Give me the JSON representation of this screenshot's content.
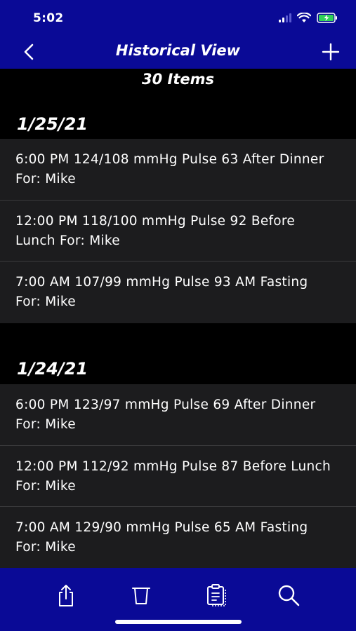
{
  "status_bar": {
    "time": "5:02"
  },
  "nav": {
    "title": "Historical View"
  },
  "items_count": "30 Items",
  "sections": [
    {
      "date": "1/25/21",
      "rows": [
        "6:00 PM 124/108 mmHg Pulse 63 After Dinner For: Mike",
        "12:00 PM 118/100 mmHg Pulse 92 Before Lunch For: Mike",
        "7:00 AM 107/99 mmHg Pulse 93 AM Fasting For: Mike"
      ]
    },
    {
      "date": "1/24/21",
      "rows": [
        "6:00 PM 123/97 mmHg Pulse 69 After Dinner For: Mike",
        "12:00 PM 112/92 mmHg Pulse 87 Before Lunch For: Mike",
        "7:00 AM 129/90 mmHg Pulse 65 AM Fasting For: Mike"
      ]
    }
  ],
  "tab_bar": {
    "icons": [
      "share-icon",
      "trash-icon",
      "clipboard-icon",
      "search-icon"
    ]
  },
  "colors": {
    "brand_blue": "#0a0a96",
    "row_background": "#1c1c1e",
    "separator": "#3a3a3c",
    "battery_green": "#30d158"
  }
}
